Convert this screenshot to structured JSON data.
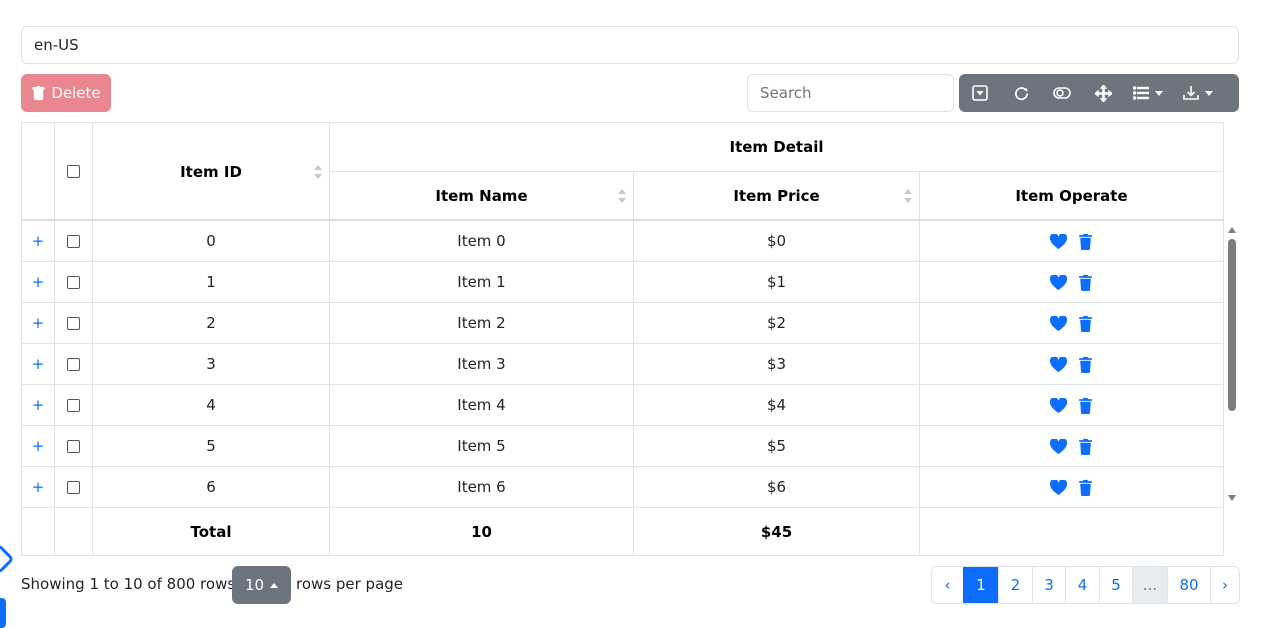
{
  "locale": {
    "value": "en-US"
  },
  "toolbar": {
    "delete_label": "Delete",
    "search_placeholder": "Search"
  },
  "table": {
    "group_header": "Item Detail",
    "headers": {
      "item_id": "Item ID",
      "item_name": "Item Name",
      "item_price": "Item Price",
      "item_operate": "Item Operate"
    },
    "rows": [
      {
        "expand": "+",
        "id": "0",
        "name": "Item 0",
        "price": "$0"
      },
      {
        "expand": "+",
        "id": "1",
        "name": "Item 1",
        "price": "$1"
      },
      {
        "expand": "+",
        "id": "2",
        "name": "Item 2",
        "price": "$2"
      },
      {
        "expand": "+",
        "id": "3",
        "name": "Item 3",
        "price": "$3"
      },
      {
        "expand": "+",
        "id": "4",
        "name": "Item 4",
        "price": "$4"
      },
      {
        "expand": "+",
        "id": "5",
        "name": "Item 5",
        "price": "$5"
      },
      {
        "expand": "+",
        "id": "6",
        "name": "Item 6",
        "price": "$6"
      }
    ],
    "footer": {
      "label": "Total",
      "name_total": "10",
      "price_total": "$45"
    }
  },
  "pagination": {
    "showing": "Showing 1 to 10 of 800 rows",
    "page_size": "10",
    "rows_per_page": "rows per page",
    "prev": "‹",
    "pages": [
      "1",
      "2",
      "3",
      "4",
      "5"
    ],
    "ellipsis": "...",
    "last": "80",
    "next": "›",
    "active_page": "1"
  },
  "colors": {
    "primary": "#0d6efd",
    "secondary": "#6c757d",
    "danger_light": "#ea868f",
    "border": "#dee2e6"
  }
}
